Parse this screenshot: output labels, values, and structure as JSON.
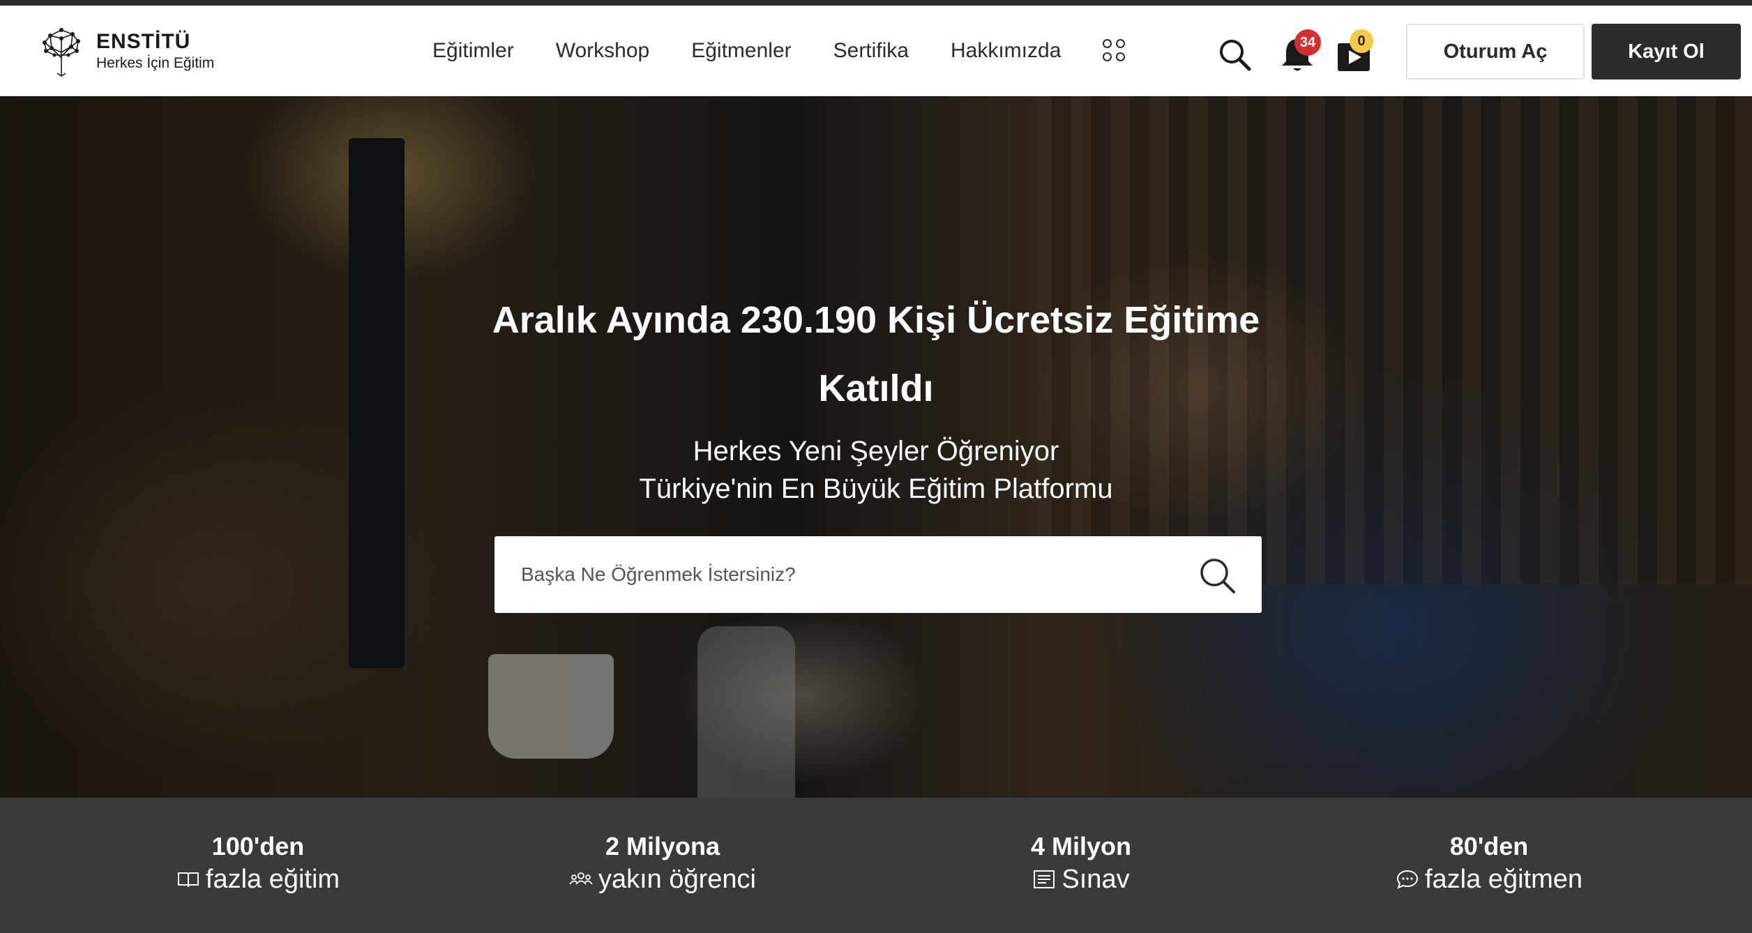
{
  "brand": {
    "name": "ENSTİTÜ",
    "tagline": "Herkes İçin Eğitim"
  },
  "nav": {
    "items": [
      "Eğitimler",
      "Workshop",
      "Eğitmenler",
      "Sertifika",
      "Hakkımızda"
    ]
  },
  "header": {
    "notification_count": "34",
    "video_count": "0",
    "login_label": "Oturum Aç",
    "signup_label": "Kayıt Ol"
  },
  "hero": {
    "title_line1": "Aralık Ayında 230.190 Kişi Ücretsiz Eğitime",
    "title_line2": "Katıldı",
    "subtitle_line1": "Herkes Yeni Şeyler Öğreniyor",
    "subtitle_line2": "Türkiye'nin En Büyük Eğitim Platformu",
    "search_placeholder": "Başka Ne Öğrenmek İstersiniz?"
  },
  "stats": [
    {
      "number": "100'den",
      "label": "fazla eğitim",
      "icon": "book-icon"
    },
    {
      "number": "2 Milyona",
      "label": "yakın öğrenci",
      "icon": "users-icon"
    },
    {
      "number": "4 Milyon",
      "label": "Sınav",
      "icon": "exam-icon"
    },
    {
      "number": "80'den",
      "label": "fazla eğitmen",
      "icon": "chat-icon"
    }
  ],
  "colors": {
    "dark": "#2b2b2b",
    "badge_red": "#d32f2f",
    "badge_yellow": "#f7c948",
    "stats_bg": "#3a3a3a"
  }
}
